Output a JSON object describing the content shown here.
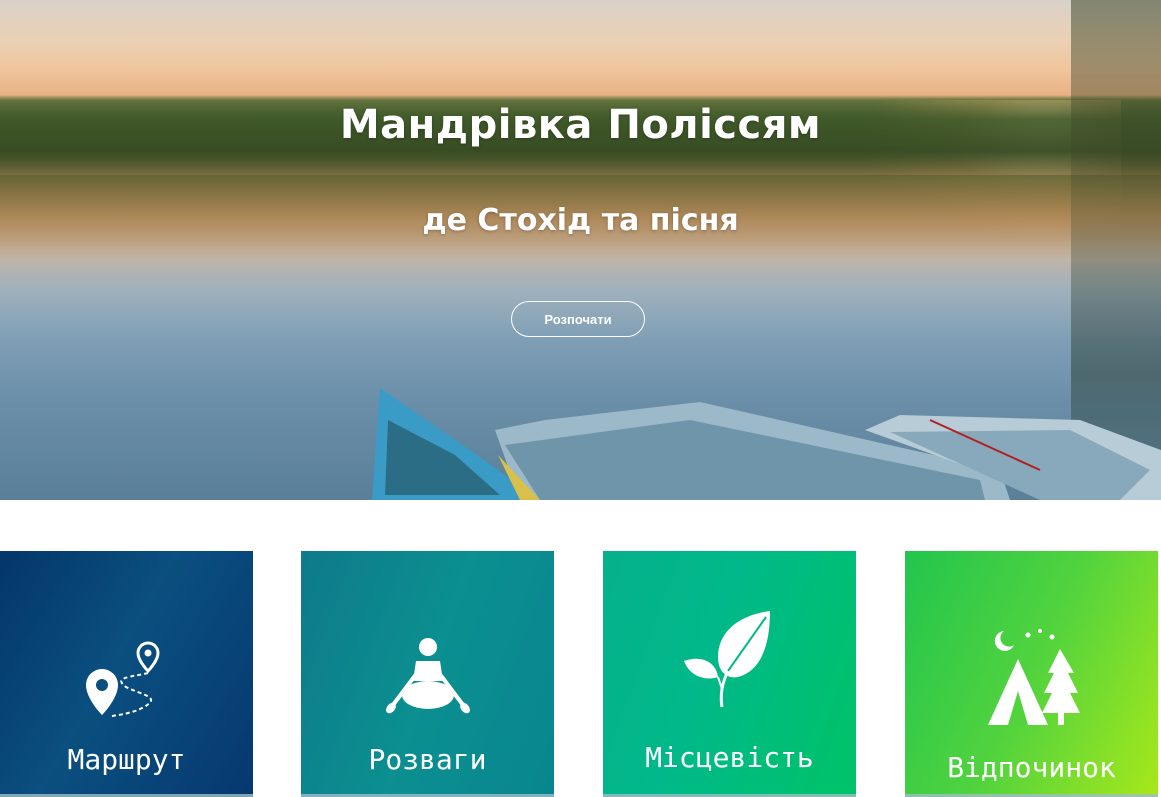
{
  "hero": {
    "title": "Мандрівка Поліссям",
    "subtitle": "де Стохід та пісня",
    "button_label": "Розпочати"
  },
  "cards": [
    {
      "label": "Маршрут",
      "icon": "route-map-pin-icon",
      "color": "#04366a"
    },
    {
      "label": "Розваги",
      "icon": "kayak-icon",
      "color": "#0b8f90"
    },
    {
      "label": "Місцевість",
      "icon": "leaf-icon",
      "color": "#00b88a"
    },
    {
      "label": "Відпочинок",
      "icon": "camping-tent-icon",
      "color": "#52d33e"
    }
  ]
}
